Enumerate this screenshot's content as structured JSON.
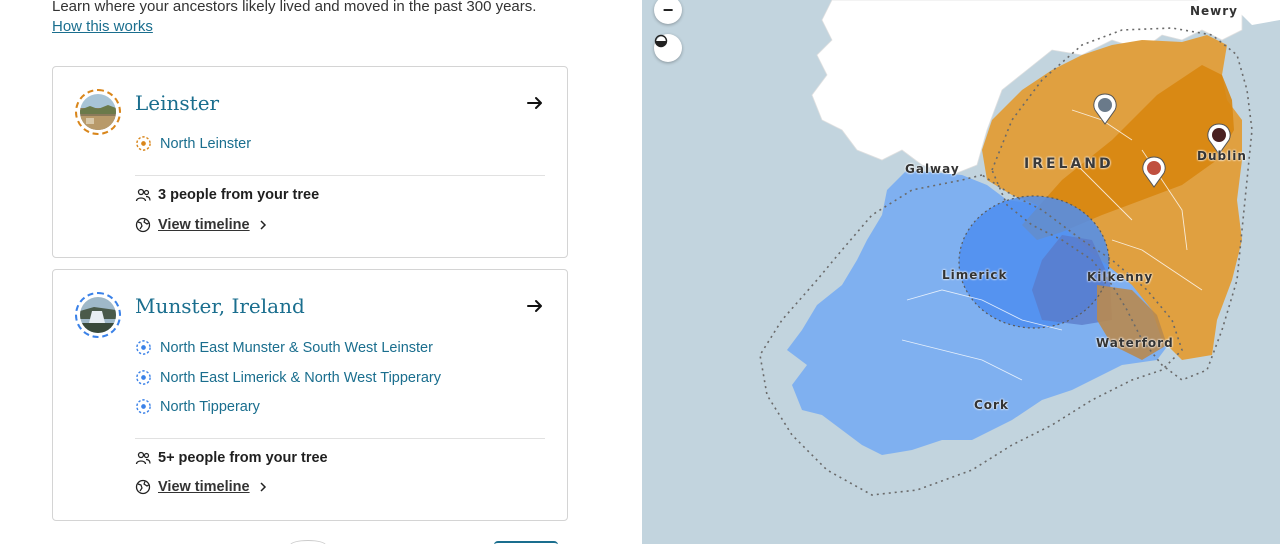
{
  "intro": {
    "text": "Learn where your ancestors likely lived and moved in the past 300 years.",
    "link": "How this works"
  },
  "cards": [
    {
      "title": "Leinster",
      "color": "#d9861b",
      "regions": [
        "North Leinster"
      ],
      "people": "3 people from your tree",
      "timeline": "View timeline"
    },
    {
      "title": "Munster, Ireland",
      "color": "#3b82e8",
      "regions": [
        "North East Munster & South West Leinster",
        "North East Limerick & North West Tipperary",
        "North Tipperary"
      ],
      "people": "5+ people from your tree",
      "timeline": "View timeline"
    }
  ],
  "map": {
    "labels": {
      "newry": "Newry",
      "galway": "Galway",
      "ireland": "IRELAND",
      "dublin": "Dublin",
      "limerick": "Limerick",
      "kilkenny": "Kilkenny",
      "waterford": "Waterford",
      "cork": "Cork"
    },
    "controls": {
      "zoom_out": "−"
    },
    "colors": {
      "water": "#c2d4de",
      "land": "#ffffff",
      "leinster": "#d9861b",
      "munster": "#3b82e8"
    }
  }
}
